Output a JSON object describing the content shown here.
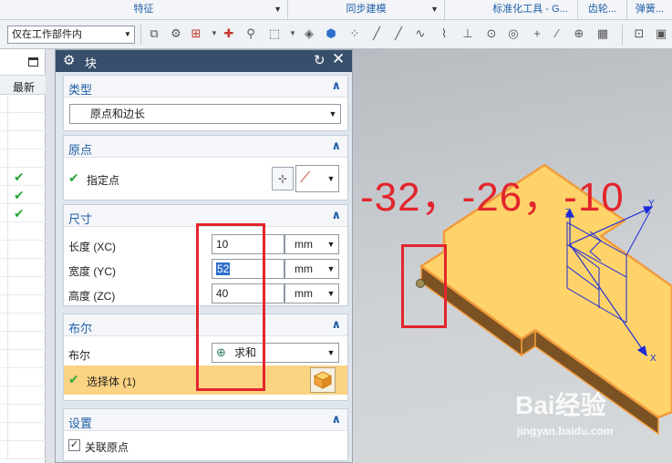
{
  "ribbon": {
    "groups": [
      {
        "label": "特征"
      },
      {
        "label": "同步建模"
      },
      {
        "label": "标准化工具 - G..."
      },
      {
        "label": "齿轮..."
      },
      {
        "label": "弹簧..."
      }
    ]
  },
  "toolbar": {
    "scope_value": "仅在工作部件内"
  },
  "navigator": {
    "column_header": "最新",
    "checked_rows": 3
  },
  "dialog": {
    "title": "块",
    "type_section": {
      "title": "类型",
      "value": "原点和边长"
    },
    "origin_section": {
      "title": "原点",
      "specify_point_label": "指定点"
    },
    "dimensions_section": {
      "title": "尺寸",
      "length_label": "长度 (XC)",
      "length_value": "10",
      "length_unit": "mm",
      "width_label": "宽度 (YC)",
      "width_value": "52",
      "width_unit": "mm",
      "height_label": "高度 (ZC)",
      "height_value": "40",
      "height_unit": "mm"
    },
    "boolean_section": {
      "title": "布尔",
      "boolean_label": "布尔",
      "boolean_value": "求和",
      "select_body_label": "选择体 (1)"
    },
    "settings_section": {
      "title": "设置",
      "associative_origin_label": "关联原点",
      "associative_origin_checked": true
    }
  },
  "viewport": {
    "coordinate_annotation": "-32，-26，-10",
    "axis_labels": {
      "z": "Z",
      "y": "Y",
      "x": "X"
    }
  },
  "watermark": {
    "brand": "Bai经验",
    "url": "jingyan.baidu.com"
  },
  "colors": {
    "dialog_title_bg": "#384f6b",
    "section_title": "#1f5fa6",
    "check_green": "#2da83a",
    "annotation_red": "#e3252d",
    "solid_top": "#fdd36a",
    "solid_edge": "#f39b3a",
    "solid_side": "#7a5224",
    "selection_bg": "#fbd382"
  }
}
